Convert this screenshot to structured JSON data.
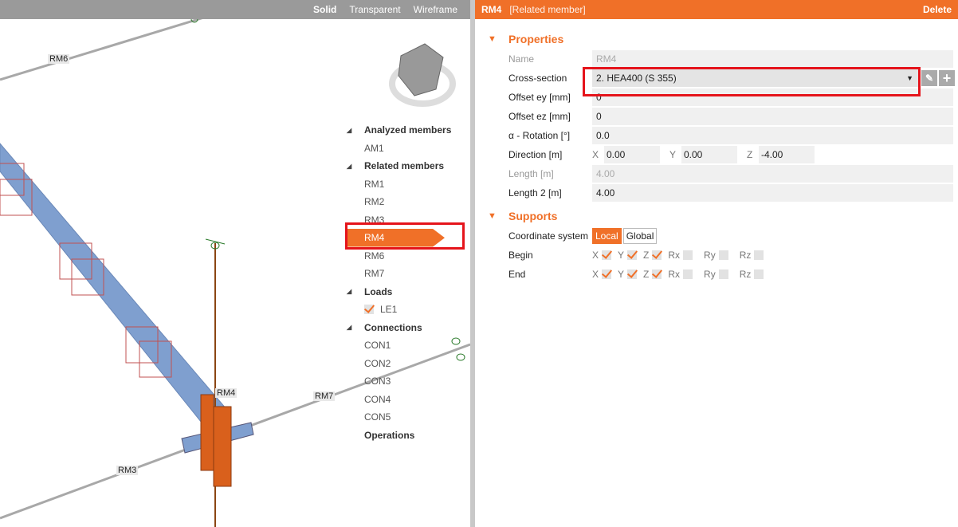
{
  "viewport": {
    "modes": [
      {
        "label": "Solid",
        "active": true
      },
      {
        "label": "Transparent",
        "active": false
      },
      {
        "label": "Wireframe",
        "active": false
      }
    ],
    "labels": {
      "rm6": "RM6",
      "rm4": "RM4",
      "rm7": "RM7",
      "rm3": "RM3"
    }
  },
  "tree": {
    "groups": [
      {
        "label": "Analyzed members",
        "items": [
          "AM1"
        ]
      },
      {
        "label": "Related members",
        "items": [
          "RM1",
          "RM2",
          "RM3",
          "RM4",
          "RM6",
          "RM7"
        ],
        "selected": "RM4"
      },
      {
        "label": "Loads",
        "items": [
          "LE1"
        ]
      },
      {
        "label": "Connections",
        "items": [
          "CON1",
          "CON2",
          "CON3",
          "CON4",
          "CON5"
        ]
      },
      {
        "label": "Operations",
        "items": []
      }
    ]
  },
  "panel": {
    "title": "RM4",
    "subtitle": "[Related member]",
    "delete": "Delete",
    "properties": {
      "heading": "Properties",
      "name_label": "Name",
      "name": "RM4",
      "cs_label": "Cross-section",
      "cs": "2. HEA400 (S 355)",
      "ey_label": "Offset ey [mm]",
      "ey": "0",
      "ez_label": "Offset ez [mm]",
      "ez": "0",
      "rot_label": "α - Rotation [°]",
      "rot": "0.0",
      "dir_label": "Direction [m]",
      "dx": "0.00",
      "dy": "0.00",
      "dz": "-4.00",
      "ax_x": "X",
      "ax_y": "Y",
      "ax_z": "Z",
      "len_label": "Length [m]",
      "len": "4.00",
      "len2_label": "Length 2 [m]",
      "len2": "4.00"
    },
    "supports": {
      "heading": "Supports",
      "cs_label": "Coordinate system",
      "local": "Local",
      "global": "Global",
      "begin_label": "Begin",
      "end_label": "End",
      "dofs": [
        "X",
        "Y",
        "Z",
        "Rx",
        "Ry",
        "Rz"
      ],
      "begin": [
        true,
        true,
        true,
        false,
        false,
        false
      ],
      "end": [
        true,
        true,
        true,
        false,
        false,
        false
      ]
    }
  },
  "colors": {
    "accent": "#f07028",
    "beam": "#7f9fcf",
    "highlight": "#e5141b"
  }
}
